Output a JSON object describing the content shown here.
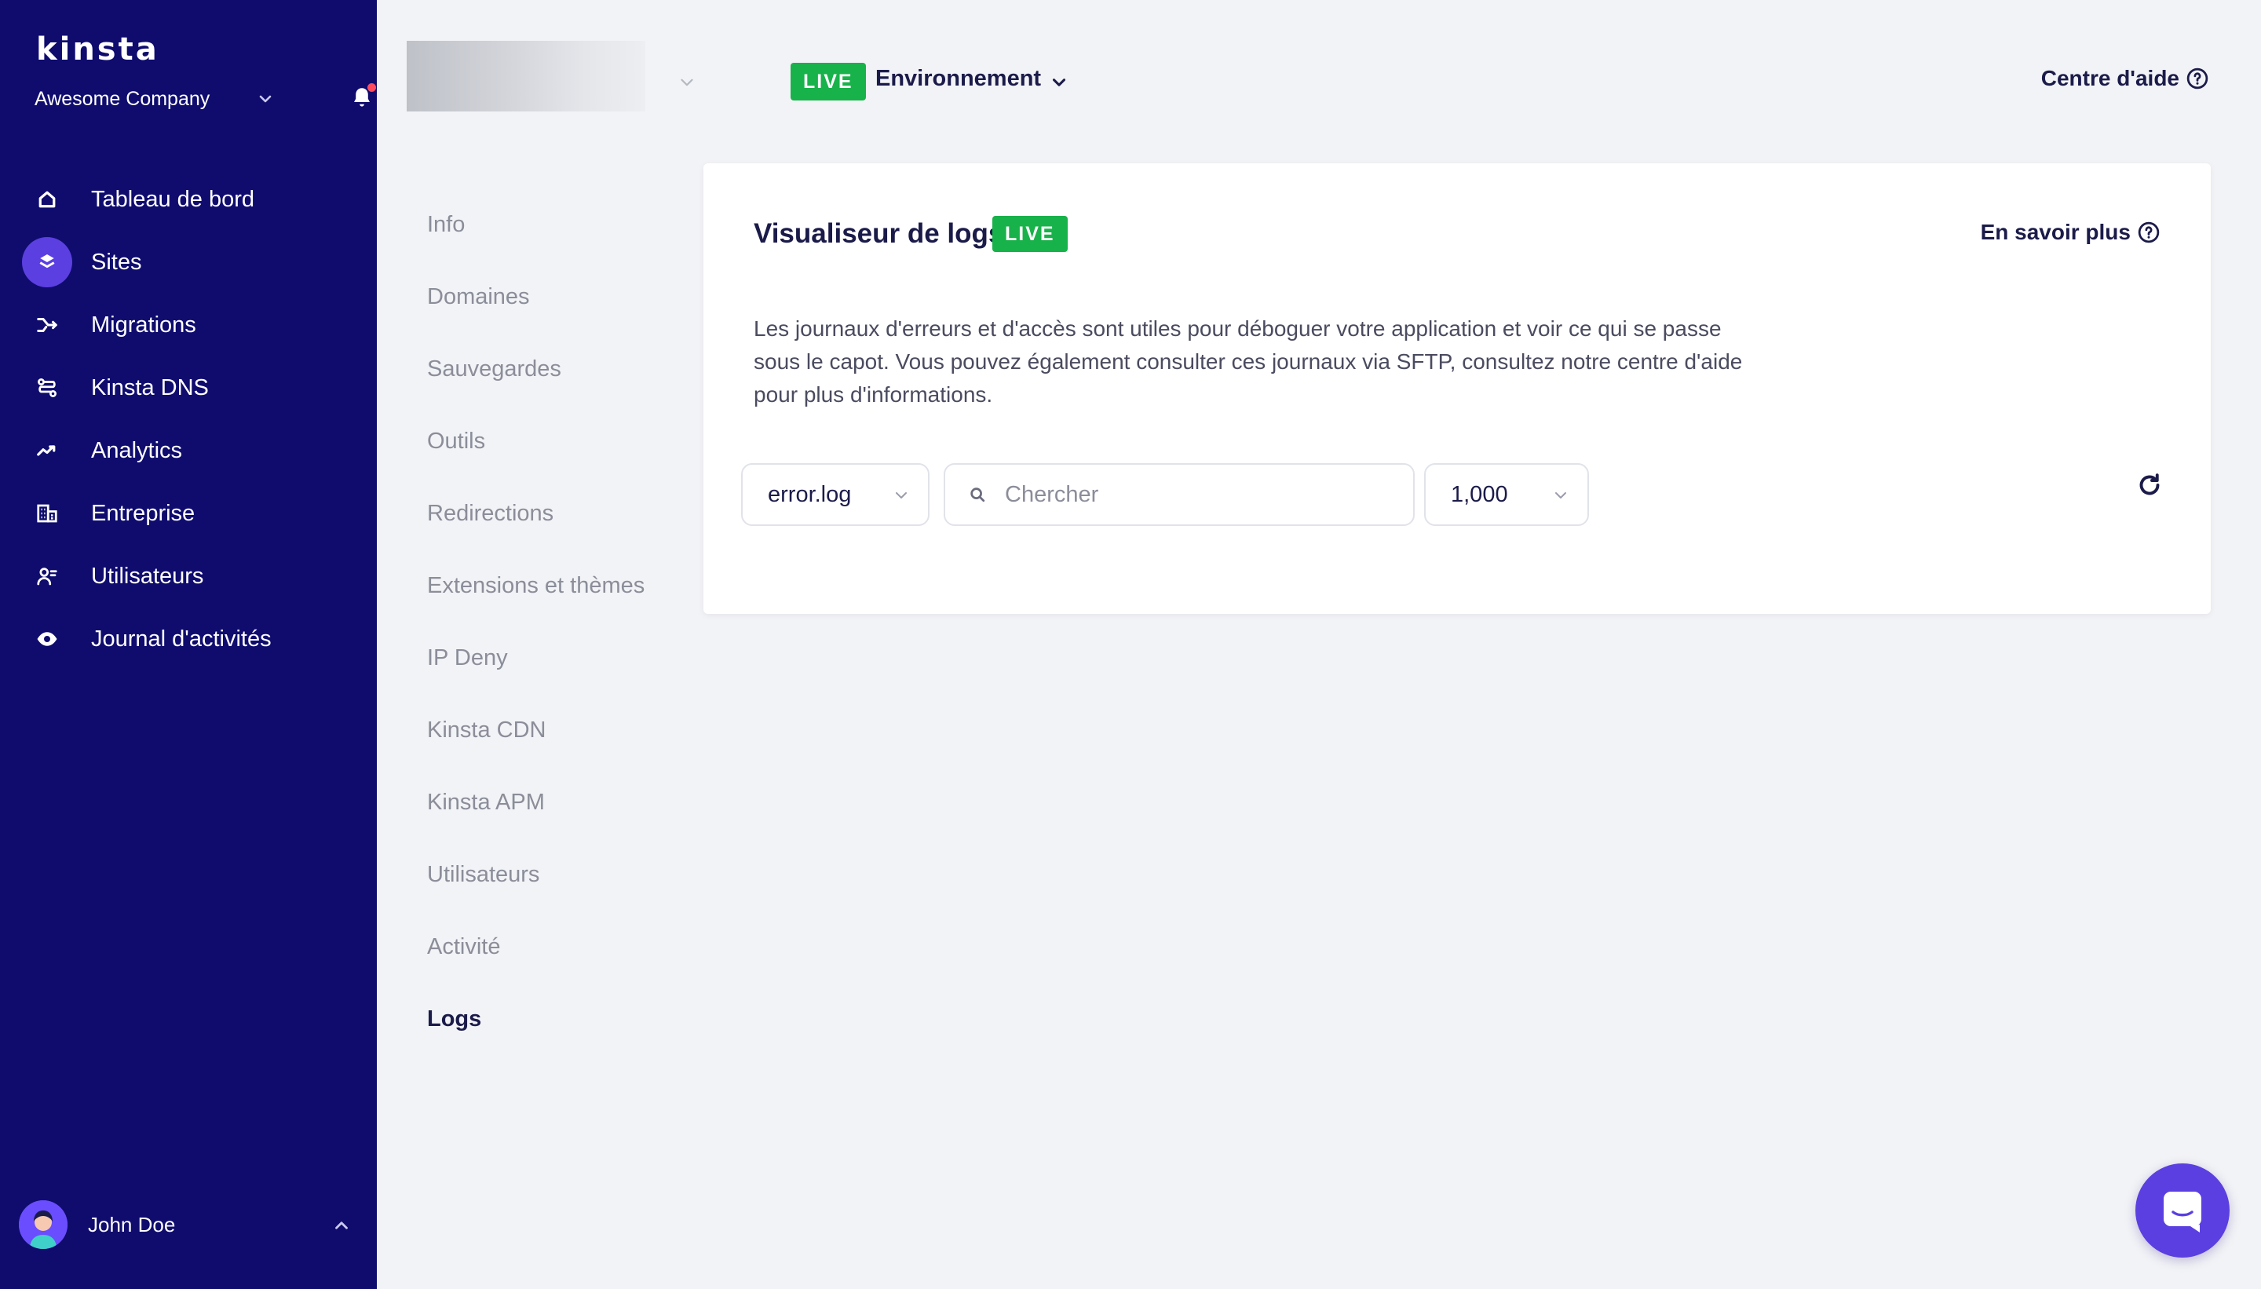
{
  "brand": {
    "logo_text": "kinsta"
  },
  "company": {
    "name": "Awesome Company"
  },
  "sidebar": {
    "items": [
      {
        "label": "Tableau de bord",
        "icon": "home-icon",
        "active": false
      },
      {
        "label": "Sites",
        "icon": "layers-icon",
        "active": true
      },
      {
        "label": "Migrations",
        "icon": "migrations-icon",
        "active": false
      },
      {
        "label": "Kinsta DNS",
        "icon": "dns-icon",
        "active": false
      },
      {
        "label": "Analytics",
        "icon": "analytics-icon",
        "active": false
      },
      {
        "label": "Entreprise",
        "icon": "building-icon",
        "active": false
      },
      {
        "label": "Utilisateurs",
        "icon": "users-icon",
        "active": false
      },
      {
        "label": "Journal d'activités",
        "icon": "eye-icon",
        "active": false
      }
    ]
  },
  "user": {
    "name": "John Doe"
  },
  "topbar": {
    "env_badge": "LIVE",
    "env_label": "Environnement",
    "help_label": "Centre d'aide"
  },
  "subnav": {
    "items": [
      {
        "label": "Info",
        "active": false
      },
      {
        "label": "Domaines",
        "active": false
      },
      {
        "label": "Sauvegardes",
        "active": false
      },
      {
        "label": "Outils",
        "active": false
      },
      {
        "label": "Redirections",
        "active": false
      },
      {
        "label": "Extensions et thèmes",
        "active": false
      },
      {
        "label": "IP Deny",
        "active": false
      },
      {
        "label": "Kinsta CDN",
        "active": false
      },
      {
        "label": "Kinsta APM",
        "active": false
      },
      {
        "label": "Utilisateurs",
        "active": false
      },
      {
        "label": "Activité",
        "active": false
      },
      {
        "label": "Logs",
        "active": true
      }
    ]
  },
  "card": {
    "title": "Visualiseur de logs",
    "badge": "LIVE",
    "learn_more": "En savoir plus",
    "description": "Les journaux d'erreurs et d'accès sont utiles pour déboguer votre application et voir ce qui se passe sous le capot. Vous pouvez également consulter ces journaux via SFTP, consultez notre centre d'aide pour plus d'informations.",
    "log_file": "error.log",
    "search_placeholder": "Chercher",
    "search_value": "",
    "lines": "1,000"
  },
  "colors": {
    "sidebar_bg": "#0f0c6e",
    "accent": "#5b3fe0",
    "live_green": "#18b24a",
    "page_bg": "#f2f3f6",
    "notification_dot": "#ff4b5c"
  }
}
